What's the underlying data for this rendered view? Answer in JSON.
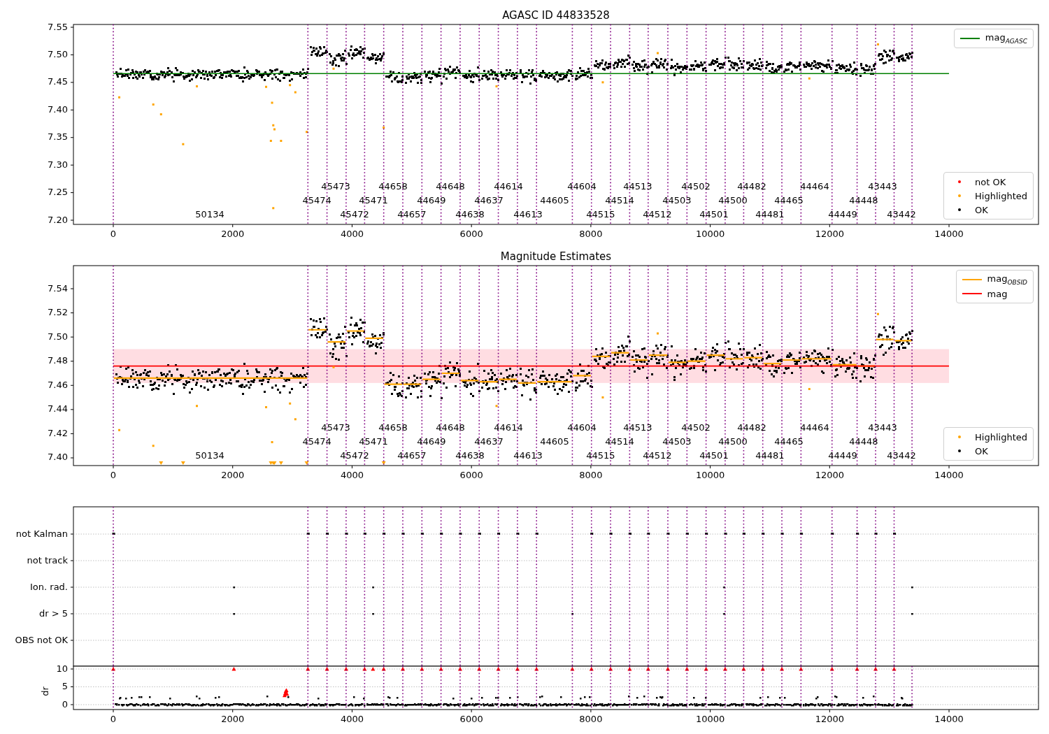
{
  "panels": [
    {
      "title": "AGASC ID 44833528",
      "y_tick_labels": [
        "7.55",
        "7.50",
        "7.45",
        "7.40",
        "7.35",
        "7.30",
        "7.25",
        "7.20"
      ],
      "x_tick_labels": [
        "0",
        "2000",
        "4000",
        "6000",
        "8000",
        "10000",
        "12000",
        "14000"
      ],
      "obsid_labels": [
        "50134",
        "45474",
        "45473",
        "45472",
        "45471",
        "44658",
        "44657",
        "44649",
        "44648",
        "44638",
        "44637",
        "44614",
        "44613",
        "44605",
        "44604",
        "44515",
        "44514",
        "44513",
        "44512",
        "44503",
        "44502",
        "44501",
        "44500",
        "44482",
        "44481",
        "44465",
        "44464",
        "44449",
        "44448",
        "43443",
        "43442"
      ],
      "legends": [
        [
          {
            "label": "mag$_{AGASC}$",
            "kind": "line",
            "color": "#008000"
          }
        ],
        [
          {
            "label": "not OK",
            "kind": "dot",
            "color": "#ff0000"
          },
          {
            "label": "Highlighted",
            "kind": "dot",
            "color": "#ffa500"
          },
          {
            "label": "OK",
            "kind": "dot",
            "color": "#000000"
          }
        ]
      ]
    },
    {
      "title": "Magnitude Estimates",
      "y_tick_labels": [
        "7.54",
        "7.52",
        "7.50",
        "7.48",
        "7.46",
        "7.44",
        "7.42",
        "7.40"
      ],
      "x_tick_labels": [
        "0",
        "2000",
        "4000",
        "6000",
        "8000",
        "10000",
        "12000",
        "14000"
      ],
      "obsid_labels": [
        "50134",
        "45474",
        "45473",
        "45472",
        "45471",
        "44658",
        "44657",
        "44649",
        "44648",
        "44638",
        "44637",
        "44614",
        "44613",
        "44605",
        "44604",
        "44515",
        "44514",
        "44513",
        "44512",
        "44503",
        "44502",
        "44501",
        "44500",
        "44482",
        "44481",
        "44465",
        "44464",
        "44449",
        "44448",
        "43443",
        "43442"
      ],
      "legends": [
        [
          {
            "label": "mag$_{OBSID}$",
            "kind": "line",
            "color": "#ffa500"
          },
          {
            "label": "mag",
            "kind": "line",
            "color": "#ff0000"
          }
        ],
        [
          {
            "label": "Highlighted",
            "kind": "dot",
            "color": "#ffa500"
          },
          {
            "label": "OK",
            "kind": "dot",
            "color": "#000000"
          }
        ]
      ]
    },
    {
      "row_labels": [
        "not Kalman",
        "not track",
        "Ion. rad.",
        "dr > 5",
        "OBS not OK"
      ]
    },
    {
      "ylabel": "dr",
      "y_tick_labels": [
        "10",
        "5",
        "0"
      ],
      "x_tick_labels": [
        "0",
        "2000",
        "4000",
        "6000",
        "8000",
        "10000",
        "12000",
        "14000"
      ]
    }
  ]
}
